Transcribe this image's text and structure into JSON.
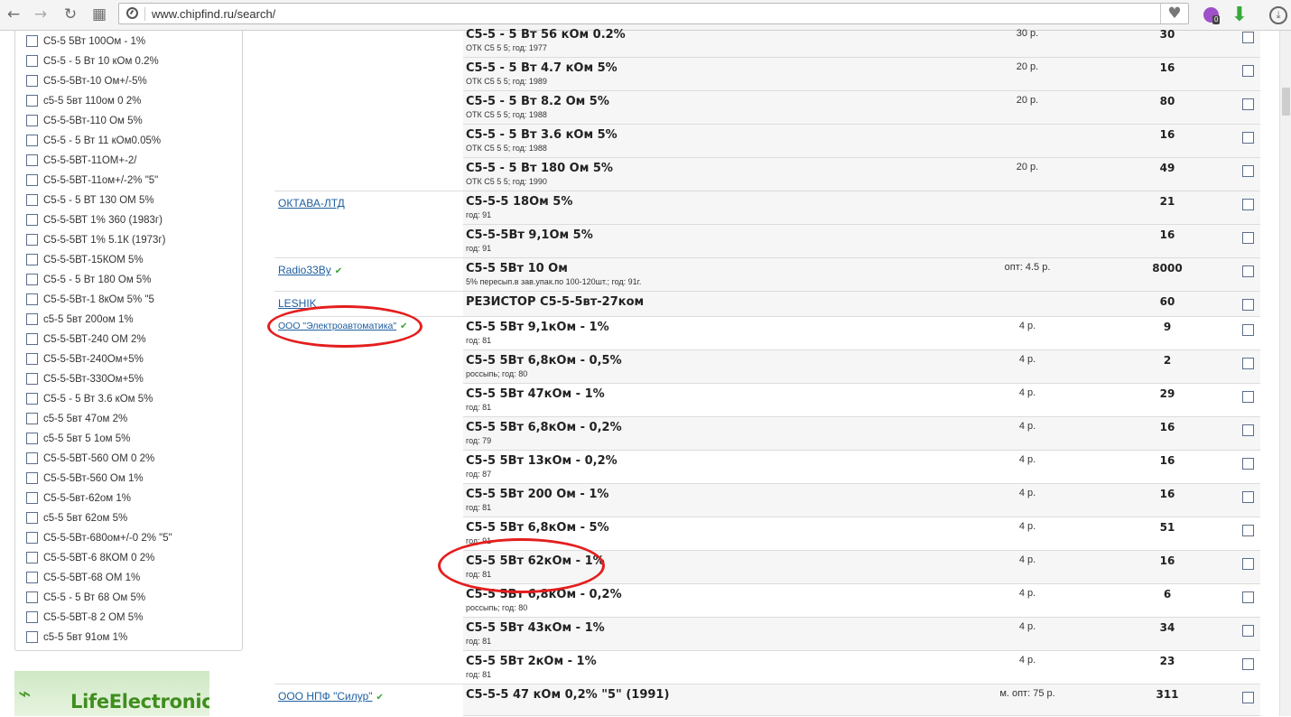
{
  "browser": {
    "url": "www.chipfind.ru/search/",
    "back_icon": "←",
    "forward_icon": "→",
    "reload_icon": "↻",
    "apps_icon": "▦",
    "heart_icon": "♥",
    "ext_badge": "0",
    "download_icon": "⬇",
    "menu_icon": "⤓"
  },
  "filters": [
    "С5-5 5Вт 100Ом - 1%",
    "С5-5 - 5 Вт 10 кОм 0.2%",
    "С5-5-5Вт-10 Ом+/-5%",
    "с5-5 5вт 110ом 0 2%",
    "С5-5-5Вт-110 Ом 5%",
    "С5-5 - 5 Вт 11 кОм0.05%",
    "С5-5-5ВТ-11ОМ+-2/",
    "С5-5-5ВТ-11ом+/-2% \"5\"",
    "С5-5 - 5 ВТ 130 ОМ 5%",
    "С5-5-5ВТ 1% 360 (1983г)",
    "С5-5-5ВТ 1% 5.1К (1973г)",
    "С5-5-5ВТ-15КОМ 5%",
    "С5-5 - 5 Вт 180 Ом 5%",
    "С5-5-5Вт-1 8кОм 5% \"5",
    "с5-5 5вт 200ом 1%",
    "С5-5-5ВТ-240 ОМ 2%",
    "С5-5-5Вт-240Ом+5%",
    "С5-5-5Вт-330Ом+5%",
    "С5-5 - 5 Вт 3.6 кОм 5%",
    "с5-5 5вт 47ом 2%",
    "с5-5 5вт 5 1ом 5%",
    "С5-5-5ВТ-560 ОМ 0 2%",
    "С5-5-5Вт-560 Ом 1%",
    "С5-5-5вт-62ом 1%",
    "с5-5 5вт 62ом 5%",
    "С5-5-5Вт-680ом+/-0 2% \"5\"",
    "С5-5-5ВТ-6 8КОМ 0 2%",
    "С5-5-5ВТ-68 ОМ 1%",
    "С5-5 - 5 Вт 68 Ом 5%",
    "С5-5-5ВТ-8 2 ОМ 5%",
    "с5-5 5вт 91ом 1%"
  ],
  "logo": {
    "icon": "⌁",
    "text": "LifeElectronics"
  },
  "suppliers": {
    "oktava": "ОКТАВА-ЛТД",
    "radio": "Radio33By",
    "leshik": "LESHIK",
    "elektro": "ООО \"Электроавтоматика\"",
    "silur": "ООО НПФ \"Силур\"",
    "check": "✔"
  },
  "rows": [
    {
      "name": "С5-5 - 5 Вт 56 кОм 0.2%",
      "sub": "ОТК С5 5 5; год: 1977",
      "price": "30 р.",
      "qty": "30"
    },
    {
      "name": "С5-5 - 5 Вт 4.7 кОм 5%",
      "sub": "ОТК С5 5 5; год: 1989",
      "price": "20 р.",
      "qty": "16"
    },
    {
      "name": "С5-5 - 5 Вт 8.2 Ом 5%",
      "sub": "ОТК С5 5 5; год: 1988",
      "price": "20 р.",
      "qty": "80"
    },
    {
      "name": "С5-5 - 5 Вт 3.6 кОм 5%",
      "sub": "ОТК С5 5 5; год: 1988",
      "price": "",
      "qty": "16"
    },
    {
      "name": "С5-5 - 5 Вт 180 Ом 5%",
      "sub": "ОТК С5 5 5; год: 1990",
      "price": "20 р.",
      "qty": "49"
    },
    {
      "name": "С5-5-5 18Ом 5%",
      "sub": "год: 91",
      "price": "",
      "qty": "21"
    },
    {
      "name": "С5-5-5Вт 9,1Ом 5%",
      "sub": "год: 91",
      "price": "",
      "qty": "16"
    },
    {
      "name": "С5-5 5Вт 10 Ом",
      "sub": "5% пересып.в зав.упак.по 100-120шт.; год: 91г.",
      "price": "опт: 4.5 р.",
      "qty": "8000"
    },
    {
      "name": "РЕЗИСТОР С5-5-5вт-27ком",
      "sub": "",
      "price": "",
      "qty": "60"
    },
    {
      "name": "С5-5 5Вт 9,1кОм - 1%",
      "sub": "год: 81",
      "price": "4 р.",
      "qty": "9"
    },
    {
      "name": "С5-5 5Вт 6,8кОм - 0,5%",
      "sub": "россыпь; год: 80",
      "price": "4 р.",
      "qty": "2"
    },
    {
      "name": "С5-5 5Вт 47кОм - 1%",
      "sub": "год: 81",
      "price": "4 р.",
      "qty": "29"
    },
    {
      "name": "С5-5 5Вт 6,8кОм - 0,2%",
      "sub": "год: 79",
      "price": "4 р.",
      "qty": "16"
    },
    {
      "name": "С5-5 5Вт 13кОм - 0,2%",
      "sub": "год: 87",
      "price": "4 р.",
      "qty": "16"
    },
    {
      "name": "С5-5 5Вт 200 Ом - 1%",
      "sub": "год: 81",
      "price": "4 р.",
      "qty": "16"
    },
    {
      "name": "С5-5 5Вт 6,8кОм - 5%",
      "sub": "год: 91",
      "price": "4 р.",
      "qty": "51"
    },
    {
      "name": "С5-5 5Вт 62кОм - 1%",
      "sub": "год: 81",
      "price": "4 р.",
      "qty": "16"
    },
    {
      "name": "С5-5 5Вт 6,8кОм - 0,2%",
      "sub": "россыпь; год: 80",
      "price": "4 р.",
      "qty": "6"
    },
    {
      "name": "С5-5 5Вт 43кОм - 1%",
      "sub": "год: 81",
      "price": "4 р.",
      "qty": "34"
    },
    {
      "name": "С5-5 5Вт 2кОм - 1%",
      "sub": "год: 81",
      "price": "4 р.",
      "qty": "23"
    },
    {
      "name": "С5-5-5 47 кОм 0,2% \"5\" (1991)",
      "sub": "",
      "price": "м. опт: 75 р.",
      "qty": "311"
    }
  ]
}
